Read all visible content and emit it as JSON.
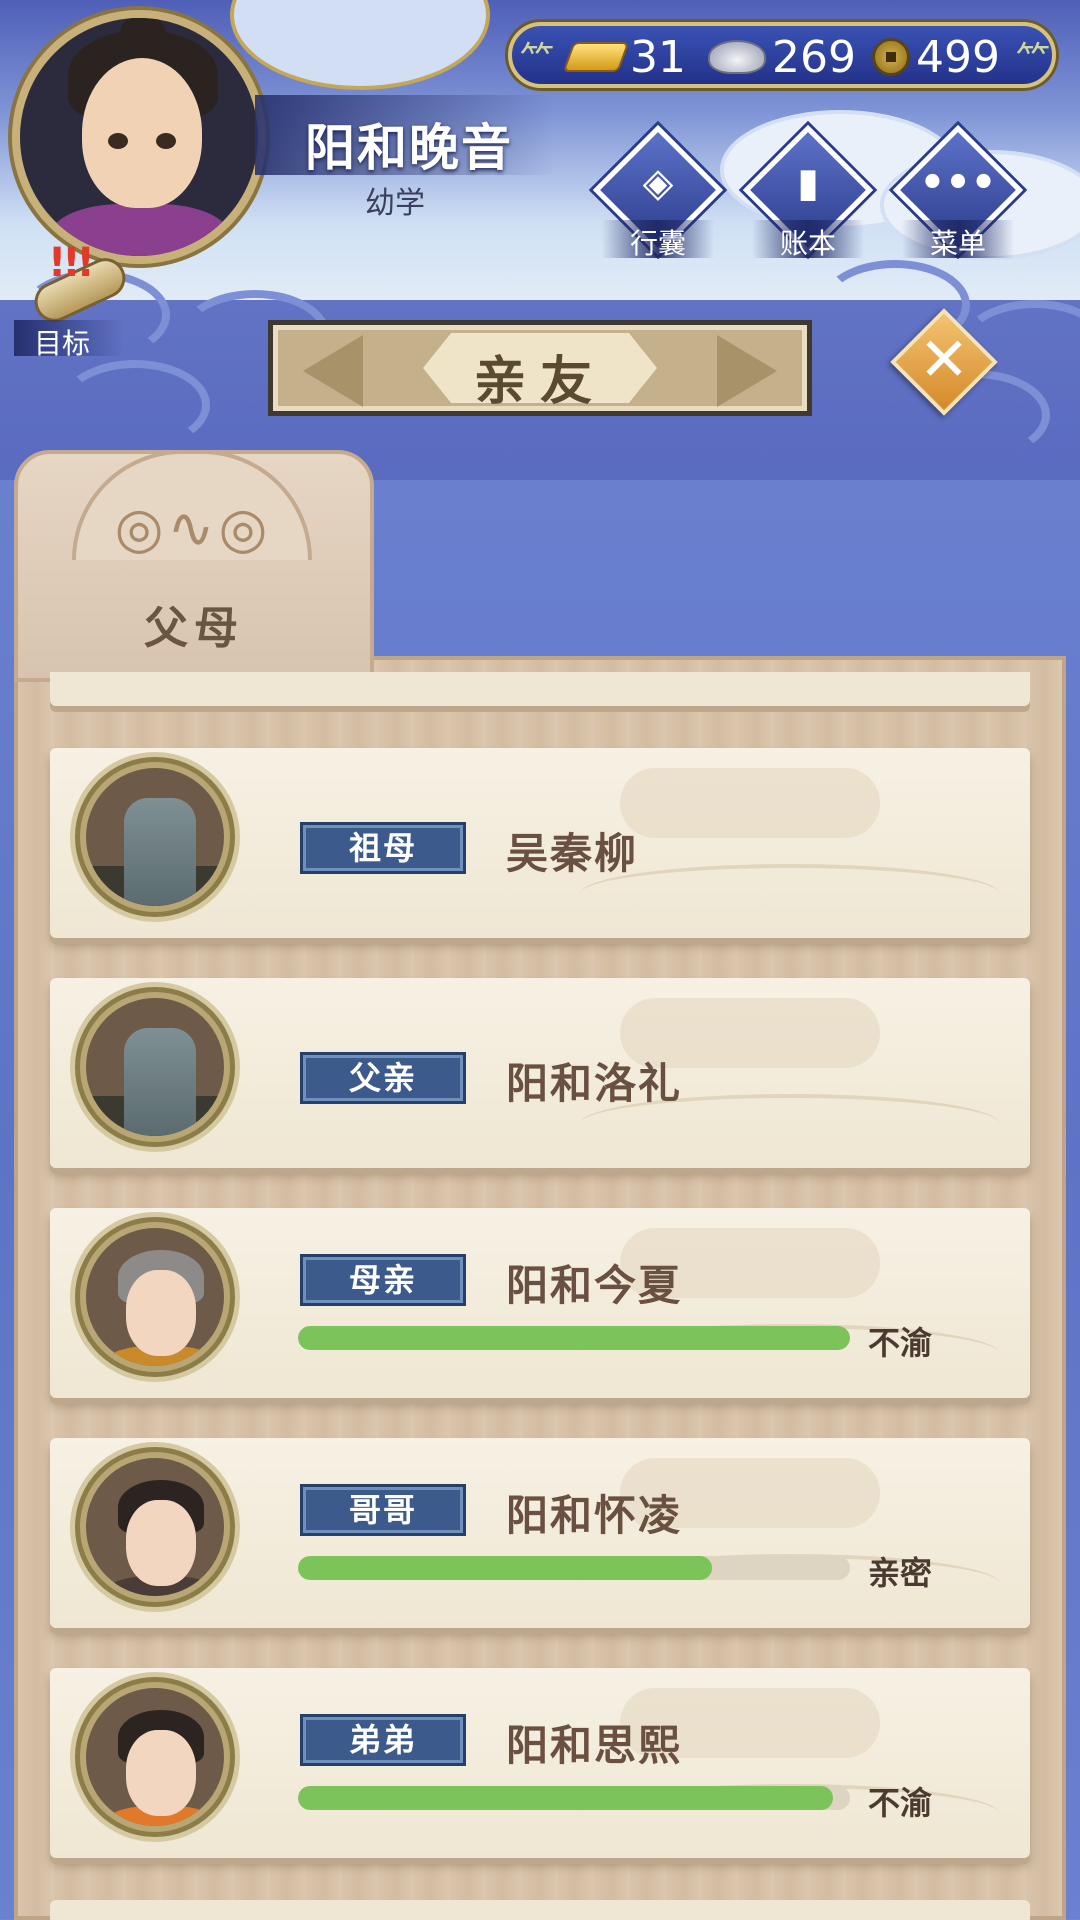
{
  "header": {
    "player_name": "阳和晚音",
    "player_stage": "幼学",
    "goal_label": "目标",
    "currencies": [
      {
        "icon": "gold-ingot-icon",
        "value": "31"
      },
      {
        "icon": "silver-ingot-icon",
        "value": "269"
      },
      {
        "icon": "copper-coin-icon",
        "value": "499"
      }
    ],
    "menu": [
      {
        "icon": "bag-icon",
        "label": "行囊"
      },
      {
        "icon": "ledger-icon",
        "label": "账本"
      },
      {
        "icon": "more-icon",
        "label": "菜单"
      }
    ]
  },
  "title": "亲友",
  "tab": {
    "label": "父母"
  },
  "relatives": [
    {
      "role": "祖母",
      "name": "吴秦柳",
      "deceased": true
    },
    {
      "role": "父亲",
      "name": "阳和洛礼",
      "deceased": true
    },
    {
      "role": "母亲",
      "name": "阳和今夏",
      "deceased": false,
      "relation_fill": 1.0,
      "mood": "不渝"
    },
    {
      "role": "哥哥",
      "name": "阳和怀凌",
      "deceased": false,
      "relation_fill": 0.75,
      "mood": "亲密"
    },
    {
      "role": "弟弟",
      "name": "阳和思熙",
      "deceased": false,
      "relation_fill": 0.97,
      "mood": "不渝"
    }
  ],
  "colors": {
    "bar_fill": "#7cc35a",
    "role_tag": "#3d5a8c",
    "close_button": "#e4a54a"
  }
}
